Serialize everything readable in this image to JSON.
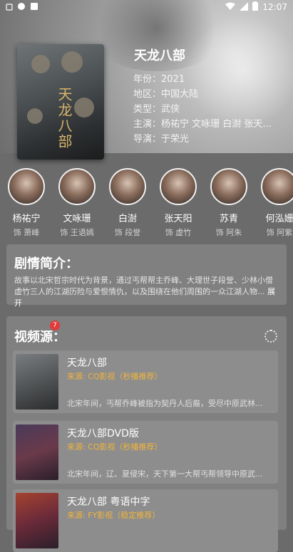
{
  "status_bar": {
    "time": "12:07"
  },
  "movie": {
    "title": "天龙八部",
    "year": "年份：2021",
    "region": "地区：中国大陆",
    "genre": "类型：武侠",
    "cast_line": "主演：杨祐宁 文咏珊 白澍 张天...",
    "director": "导演：于荣光",
    "poster_art_text": "天龙八部"
  },
  "cast": [
    {
      "name": "杨祐宁",
      "role": "饰 萧峰"
    },
    {
      "name": "文咏珊",
      "role": "饰 王语嫣"
    },
    {
      "name": "白澍",
      "role": "饰 段誉"
    },
    {
      "name": "张天阳",
      "role": "饰 虚竹"
    },
    {
      "name": "苏青",
      "role": "饰 阿朱"
    },
    {
      "name": "何泓姗",
      "role": "饰 阿紫"
    }
  ],
  "plot": {
    "heading": "剧情简介：",
    "text": "故事以北宋哲宗时代为背景，通过丐帮帮主乔峰、大理世子段誉、少林小僧虚竹三人的江湖历险与爱恨情仇，以及围绕在他们周围的一众江湖人物...",
    "more": "展开"
  },
  "sources": {
    "heading": "视频源：",
    "badge": "7",
    "items": [
      {
        "title": "天龙八部",
        "source": "来源: CQ影视（秒播推荐）",
        "desc": "北宋年间，丐帮乔峰被指为契丹人后裔，受尽中原武林..."
      },
      {
        "title": "天龙八部DVD版",
        "source": "来源: CQ影视（秒播推荐）",
        "desc": "北宋年间，辽、夏侵宋，天下第一大帮丐帮领导中原武..."
      },
      {
        "title": "天龙八部 粤语中字",
        "source": "来源: FY影视（稳定推荐）",
        "desc": ""
      }
    ]
  },
  "colors": {
    "accent": "#f1b43b",
    "badge": "#e33b3b",
    "card": "#808080"
  }
}
